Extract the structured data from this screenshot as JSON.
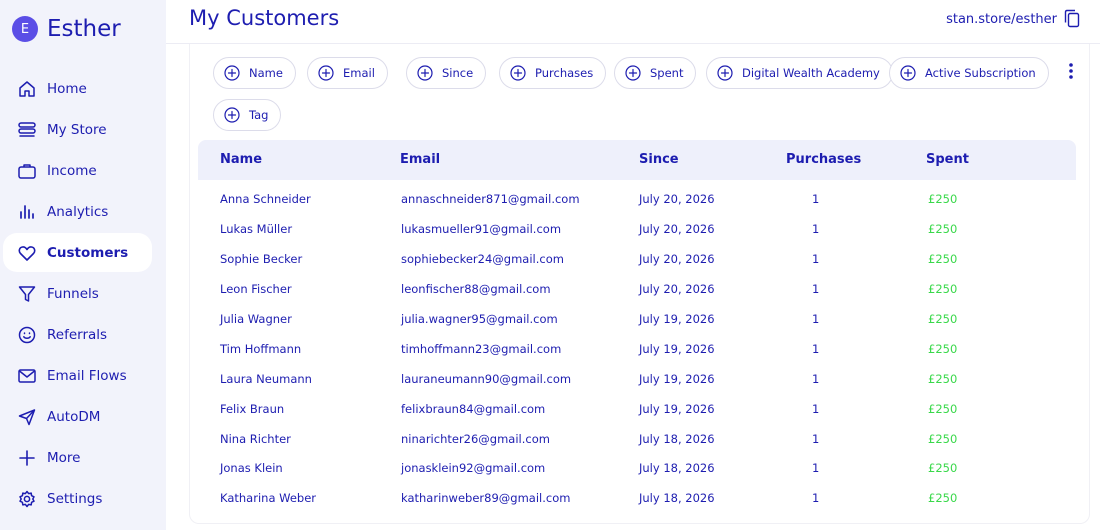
{
  "brand": {
    "initial": "E",
    "name": "Esther"
  },
  "nav": [
    {
      "label": "Home",
      "icon": "home-icon"
    },
    {
      "label": "My Store",
      "icon": "store-icon"
    },
    {
      "label": "Income",
      "icon": "briefcase-icon"
    },
    {
      "label": "Analytics",
      "icon": "analytics-icon"
    },
    {
      "label": "Customers",
      "icon": "heart-icon",
      "active": true
    },
    {
      "label": "Funnels",
      "icon": "funnel-icon"
    },
    {
      "label": "Referrals",
      "icon": "smiley-icon"
    },
    {
      "label": "Email Flows",
      "icon": "mail-icon"
    },
    {
      "label": "AutoDM",
      "icon": "send-icon"
    },
    {
      "label": "More",
      "icon": "plus-icon"
    },
    {
      "label": "Settings",
      "icon": "gear-icon"
    }
  ],
  "header": {
    "title": "My Customers",
    "store_link": "stan.store/esther"
  },
  "filters": [
    {
      "label": "Name"
    },
    {
      "label": "Email"
    },
    {
      "label": "Since"
    },
    {
      "label": "Purchases"
    },
    {
      "label": "Spent"
    },
    {
      "label": "Digital Wealth Academy"
    },
    {
      "label": "Active Subscription"
    },
    {
      "label": "Tag"
    }
  ],
  "table": {
    "columns": [
      "Name",
      "Email",
      "Since",
      "Purchases",
      "Spent"
    ],
    "rows": [
      {
        "name": "Anna Schneider",
        "email": "annaschneider871@gmail.com",
        "since": "July 20, 2026",
        "purchases": "1",
        "spent": "£250"
      },
      {
        "name": "Lukas Müller",
        "email": "lukasmueller91@gmail.com",
        "since": "July 20, 2026",
        "purchases": "1",
        "spent": "£250"
      },
      {
        "name": "Sophie Becker",
        "email": "sophiebecker24@gmail.com",
        "since": "July 20, 2026",
        "purchases": "1",
        "spent": "£250"
      },
      {
        "name": "Leon Fischer",
        "email": "leonfischer88@gmail.com",
        "since": "July 20, 2026",
        "purchases": "1",
        "spent": "£250"
      },
      {
        "name": "Julia Wagner",
        "email": "julia.wagner95@gmail.com",
        "since": "July 19, 2026",
        "purchases": "1",
        "spent": "£250"
      },
      {
        "name": "Tim Hoffmann",
        "email": "timhoffmann23@gmail.com",
        "since": "July 19, 2026",
        "purchases": "1",
        "spent": "£250"
      },
      {
        "name": "Laura Neumann",
        "email": "lauraneumann90@gmail.com",
        "since": "July 19, 2026",
        "purchases": "1",
        "spent": "£250"
      },
      {
        "name": "Felix Braun",
        "email": "felixbraun84@gmail.com",
        "since": "July 19, 2026",
        "purchases": "1",
        "spent": "£250"
      },
      {
        "name": "Nina Richter",
        "email": "ninarichter26@gmail.com",
        "since": "July 18, 2026",
        "purchases": "1",
        "spent": "£250"
      },
      {
        "name": "Jonas Klein",
        "email": "jonasklein92@gmail.com",
        "since": "July 18, 2026",
        "purchases": "1",
        "spent": "£250"
      },
      {
        "name": "Katharina Weber",
        "email": "katharinweber89@gmail.com",
        "since": "July 18, 2026",
        "purchases": "1",
        "spent": "£250"
      }
    ]
  },
  "colors": {
    "primary": "#1d1db0",
    "accent": "#5b4ee6",
    "sidebar_bg": "#f2f3fb",
    "header_bg": "#eef0fb",
    "spent": "#39d84a"
  }
}
